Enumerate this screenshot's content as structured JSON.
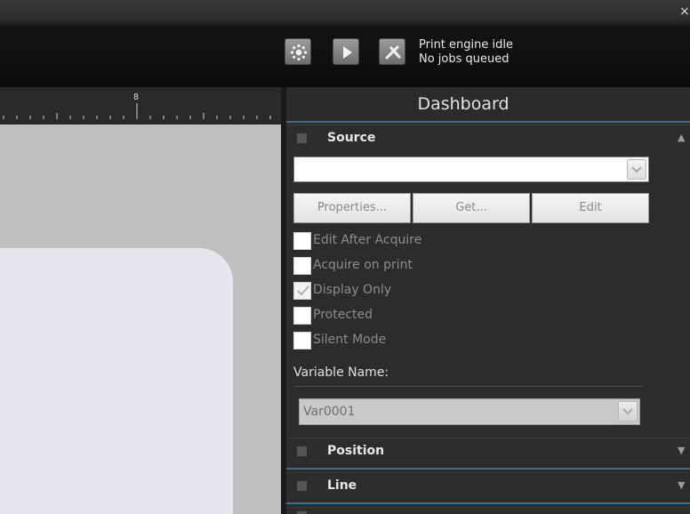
{
  "window": {
    "close_glyph": "×"
  },
  "toolbar": {
    "buttons": [
      {
        "name": "print-engine-settings-button",
        "icon": "gear-dots-icon"
      },
      {
        "name": "start-button",
        "icon": "play-icon"
      },
      {
        "name": "cancel-button",
        "icon": "cancel-x-icon"
      }
    ],
    "status_line1": "Print engine idle",
    "status_line2": "No jobs queued"
  },
  "ruler": {
    "marker_label": "8"
  },
  "dashboard": {
    "title": "Dashboard",
    "sections": {
      "source": {
        "title": "Source",
        "source_value": "",
        "buttons": {
          "properties": "Properties...",
          "get": "Get...",
          "edit": "Edit"
        },
        "checkboxes": [
          {
            "label": "Edit After Acquire",
            "checked": false
          },
          {
            "label": "Acquire on print",
            "checked": false
          },
          {
            "label": "Display Only",
            "checked": true
          },
          {
            "label": "Protected",
            "checked": false
          },
          {
            "label": "Silent Mode",
            "checked": false
          }
        ],
        "variable_name_label": "Variable Name:",
        "variable_name_value": "Var0001"
      },
      "position": {
        "title": "Position"
      },
      "line": {
        "title": "Line"
      }
    }
  },
  "colors": {
    "accent_rule": "#3c6e8c",
    "panel_bg": "#2b2b2b",
    "canvas_bg": "#bfbfbf",
    "label_bg": "#e6e6ee"
  }
}
